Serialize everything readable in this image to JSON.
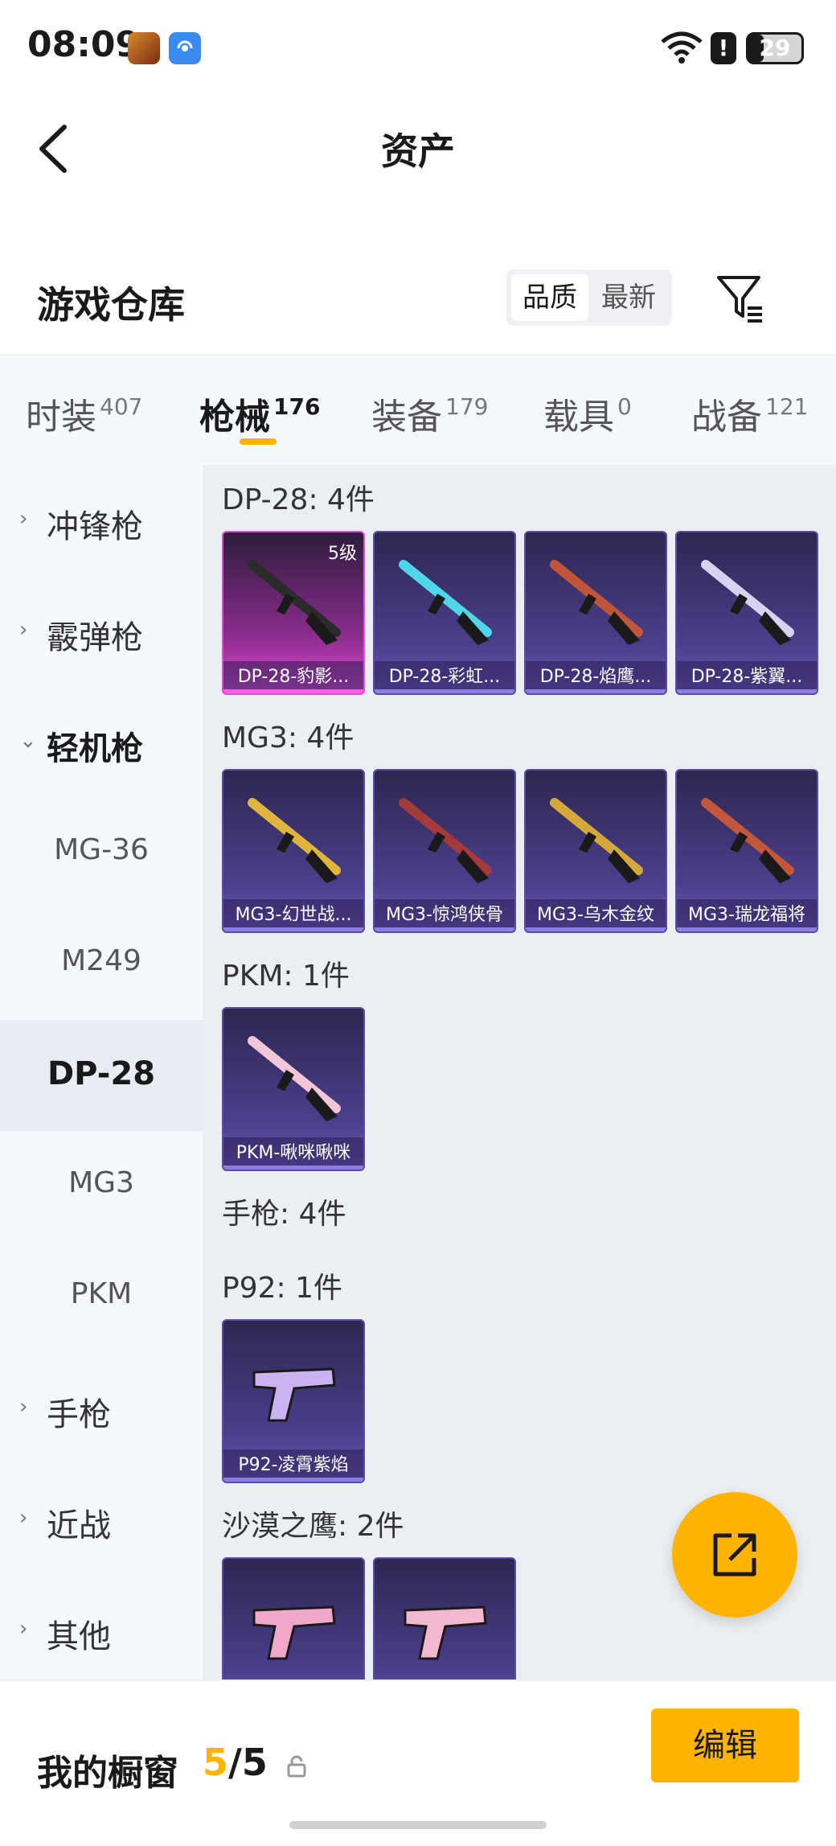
{
  "status_bar": {
    "time": "08:09",
    "battery": "29",
    "battery_level": 0.29,
    "icons": [
      "game-app-icon",
      "cast-icon",
      "wifi-icon",
      "alert-icon",
      "battery-icon"
    ]
  },
  "header": {
    "title": "资产",
    "back_icon": "chevron-left-icon"
  },
  "warehouse": {
    "title": "游戏仓库",
    "sort_options": [
      "品质",
      "最新"
    ],
    "sort_selected": "品质",
    "filter_icon": "filter-icon"
  },
  "tabs": [
    {
      "label": "时装",
      "count": "407"
    },
    {
      "label": "枪械",
      "count": "176",
      "active": true
    },
    {
      "label": "装备",
      "count": "179"
    },
    {
      "label": "载具",
      "count": "0"
    },
    {
      "label": "战备",
      "count": "121"
    }
  ],
  "sidenav": [
    {
      "label": "冲锋枪",
      "type": "category",
      "chevron": "›"
    },
    {
      "label": "霰弹枪",
      "type": "category",
      "chevron": "›"
    },
    {
      "label": "轻机枪",
      "type": "category-open",
      "chevron": "⌄"
    },
    {
      "label": "MG-36",
      "type": "sub"
    },
    {
      "label": "M249",
      "type": "sub"
    },
    {
      "label": "DP-28",
      "type": "sub-selected"
    },
    {
      "label": "MG3",
      "type": "sub"
    },
    {
      "label": "PKM",
      "type": "sub"
    },
    {
      "label": "手枪",
      "type": "category",
      "chevron": "›"
    },
    {
      "label": "近战",
      "type": "category",
      "chevron": "›"
    },
    {
      "label": "其他",
      "type": "category",
      "chevron": "›"
    }
  ],
  "groups": [
    {
      "title": "DP-28: 4件",
      "items": [
        {
          "name": "DP-28-豹影...",
          "level": "5级",
          "rarity": "pink",
          "color": "#2b2b2b"
        },
        {
          "name": "DP-28-彩虹...",
          "rarity": "purple",
          "color": "#4fd6e8"
        },
        {
          "name": "DP-28-焰鹰...",
          "rarity": "purple",
          "color": "#c0553a"
        },
        {
          "name": "DP-28-紫翼...",
          "rarity": "purple",
          "color": "#d7d2f0"
        }
      ]
    },
    {
      "title": "MG3: 4件",
      "items": [
        {
          "name": "MG3-幻世战...",
          "rarity": "purple",
          "color": "#e0b53c"
        },
        {
          "name": "MG3-惊鸿侠骨",
          "rarity": "purple",
          "color": "#a43a3a"
        },
        {
          "name": "MG3-乌木金纹",
          "rarity": "purple",
          "color": "#d4a83a"
        },
        {
          "name": "MG3-瑞龙福将",
          "rarity": "purple",
          "color": "#c3563b"
        }
      ]
    },
    {
      "title": "PKM: 1件",
      "items": [
        {
          "name": "PKM-啾咪啾咪",
          "rarity": "purple",
          "color": "#f2c6d8"
        }
      ]
    },
    {
      "title": "手枪: 4件",
      "items": []
    },
    {
      "title": "P92: 1件",
      "items": [
        {
          "name": "P92-凌霄紫焰",
          "rarity": "purple",
          "color": "#c9b4f0"
        }
      ]
    },
    {
      "title": "沙漠之鹰: 2件",
      "items": [
        {
          "name": "",
          "rarity": "purple",
          "color": "#f0a8c8"
        },
        {
          "name": "",
          "rarity": "purple",
          "color": "#f3b7cf"
        }
      ]
    }
  ],
  "fab": {
    "icon": "share-external-icon",
    "color": "#ffb400"
  },
  "bottom_bar": {
    "title": "我的橱窗",
    "count_current": "5",
    "count_sep": "/",
    "count_total": "5",
    "lock_icon": "lock-icon",
    "edit_label": "编辑"
  },
  "colors": {
    "accent": "#ffb400",
    "rarity_purple": "#5b4ea0",
    "rarity_pink": "#e14cd2"
  }
}
